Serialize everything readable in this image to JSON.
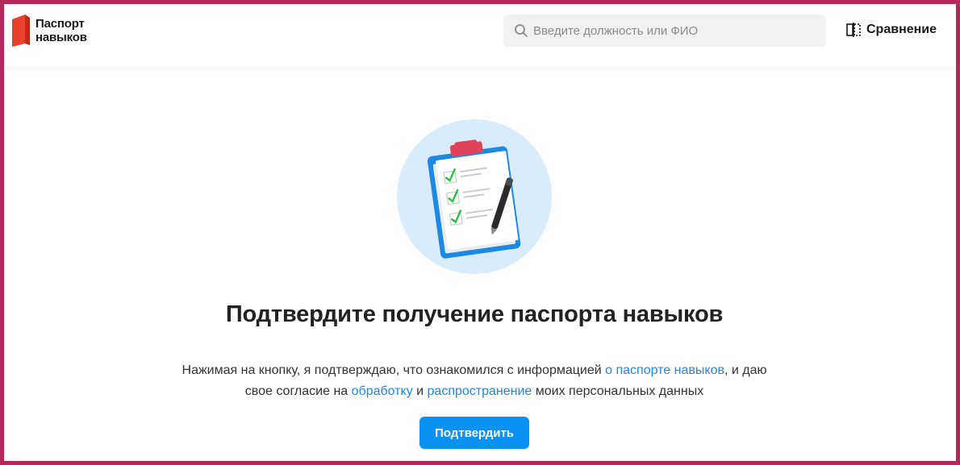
{
  "header": {
    "logo": {
      "line1": "Паспорт",
      "line2": "навыков",
      "brand_color": "#e8412c"
    },
    "search": {
      "placeholder": "Введите должность или ФИО",
      "value": ""
    },
    "compare": {
      "label": "Сравнение",
      "icon": "compare-icon"
    }
  },
  "main": {
    "illustration": {
      "icon": "clipboard-checklist-illustration"
    },
    "title": "Подтвердите получение паспорта навыков",
    "consent": {
      "part1": "Нажимая на кнопку, я подтверждаю, что ознакомился с информацией ",
      "link1": "о паспорте навыков",
      "part2": ", и даю",
      "part3": "свое согласие на ",
      "link2": "обработку",
      "part4": " и ",
      "link3": "распространение",
      "part5": " моих персональных данных"
    },
    "confirm_button": "Подтвердить"
  },
  "colors": {
    "accent": "#0a93f5",
    "link": "#1e88e5",
    "frame_border": "#b5285a"
  }
}
